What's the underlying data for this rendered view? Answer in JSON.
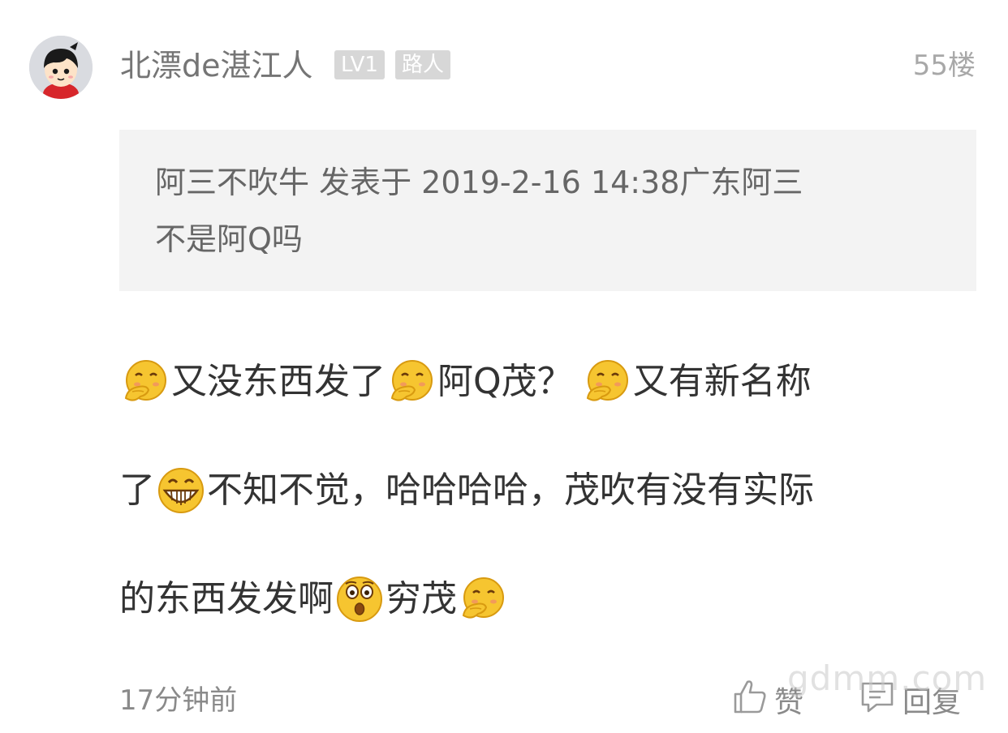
{
  "post": {
    "username": "北漂de湛江人",
    "level_badge": "LV1",
    "rank_badge": "路人",
    "floor": "55楼"
  },
  "quote": {
    "line1": "阿三不吹牛 发表于 2019-2-16 14:38广东阿三",
    "line2": "不是阿Q吗"
  },
  "content": {
    "line1": [
      "又没东西发了",
      "阿Q茂？",
      "又有新名称"
    ],
    "line2": [
      "了",
      "不知不觉，哈哈哈哈，茂吹有没有实际"
    ],
    "line3": [
      "的东西发发啊",
      "穷茂"
    ],
    "emojis": [
      "shy-laugh-emoji",
      "grin-emoji",
      "surprised-emoji"
    ]
  },
  "footer": {
    "time": "17分钟前",
    "like_label": "赞",
    "reply_label": "回复"
  },
  "watermark": "gdmm.com",
  "colors": {
    "username": "#757575",
    "badge_bg": "#d7d7d7",
    "quote_bg": "#f3f3f3",
    "text": "#333333",
    "muted": "#8a8a8a"
  }
}
